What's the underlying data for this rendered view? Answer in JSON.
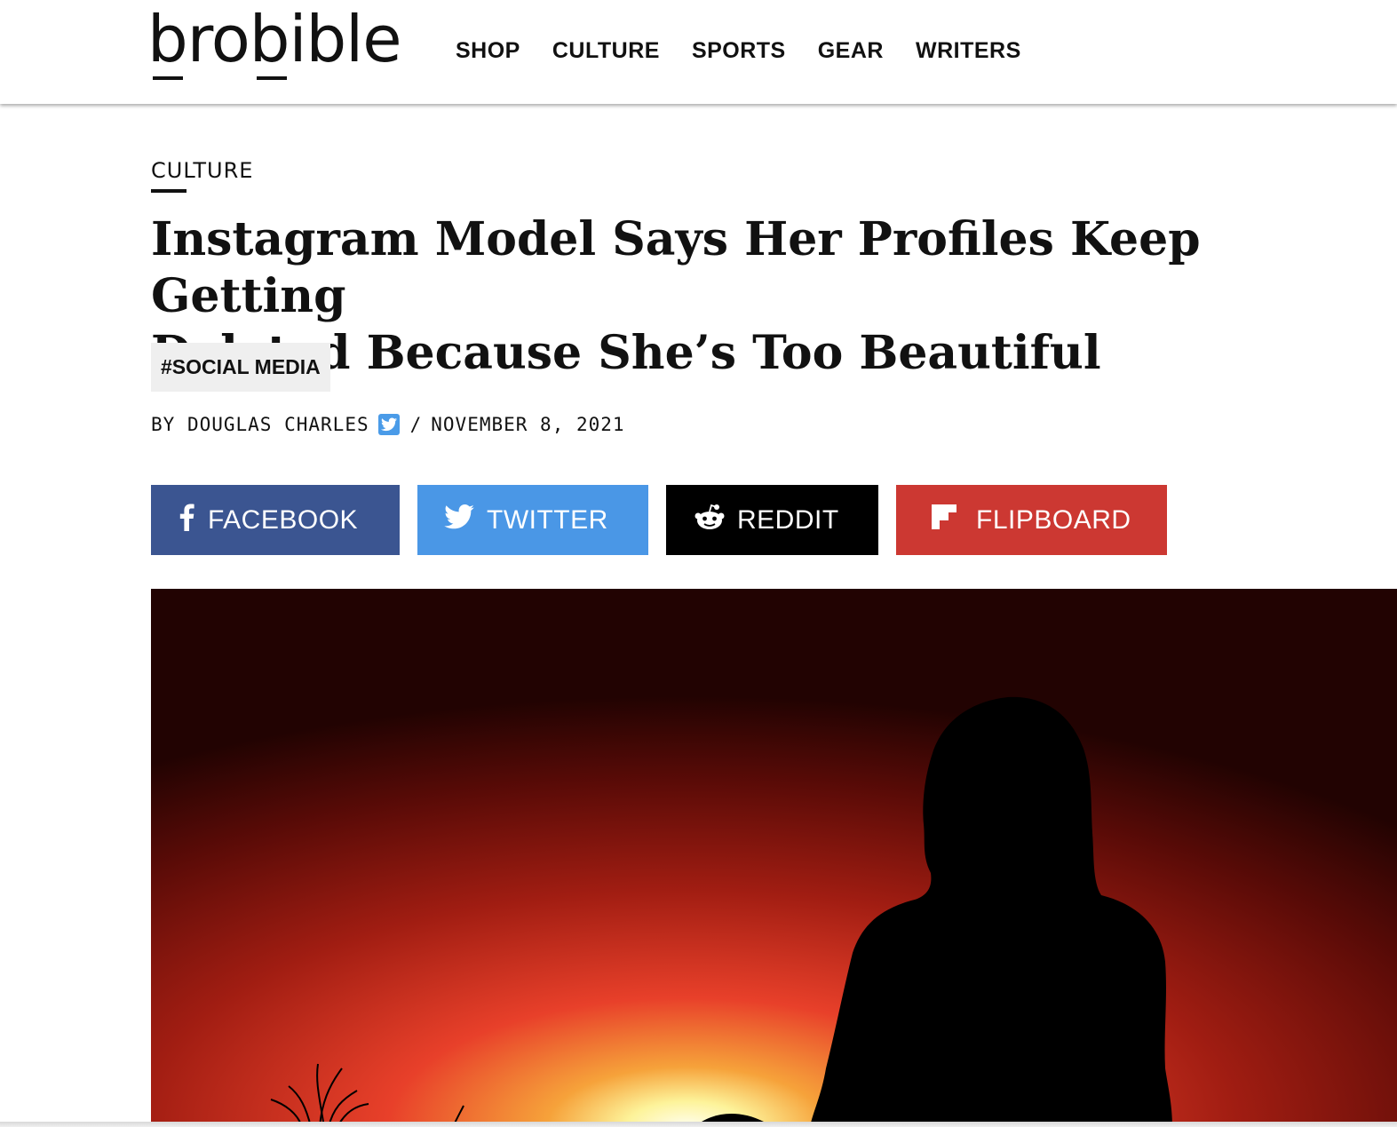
{
  "header": {
    "logo_text": "brobible",
    "nav": [
      {
        "label": "SHOP"
      },
      {
        "label": "CULTURE"
      },
      {
        "label": "SPORTS"
      },
      {
        "label": "GEAR"
      },
      {
        "label": "WRITERS"
      }
    ]
  },
  "article": {
    "category": "CULTURE",
    "headline_line1": "Instagram Model Says Her Profiles Keep Getting",
    "headline_line2": "Deleted Because She’s Too Beautiful",
    "tag": "#SOCIAL MEDIA",
    "byline": {
      "prefix": "BY",
      "author": "DOUGLAS CHARLES",
      "separator": "/",
      "date": "NOVEMBER 8, 2021"
    }
  },
  "share": {
    "facebook": {
      "label": "FACEBOOK",
      "icon": "facebook-icon",
      "color": "#3b5591"
    },
    "twitter": {
      "label": "TWITTER",
      "icon": "twitter-icon",
      "color": "#4a97e6"
    },
    "reddit": {
      "label": "REDDIT",
      "icon": "reddit-icon",
      "color": "#000000"
    },
    "flipboard": {
      "label": "FLIPBOARD",
      "icon": "flipboard-icon",
      "color": "#cc3832"
    }
  },
  "hero": {
    "subject": "silhouette of a woman against a red sunset"
  },
  "colors": {
    "accent_twitter_badge": "#4a9be8",
    "tag_background": "#efefef"
  }
}
